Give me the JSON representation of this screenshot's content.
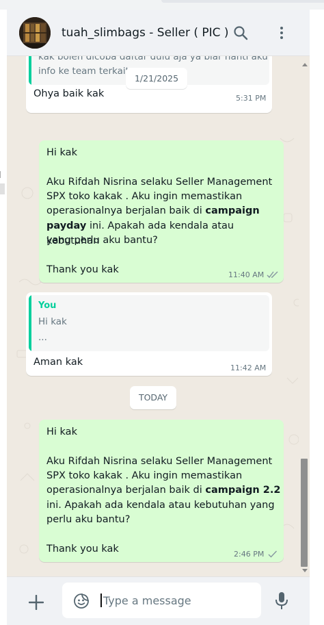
{
  "header": {
    "title": "tuah_slimbags - Seller ( PIC )",
    "search_icon": "search-icon",
    "menu_icon": "kebab-menu-icon"
  },
  "chat": {
    "partial_quote_line1": "kak boleh dicoba daftar dulu aja ya biar nanti aku",
    "partial_quote_line2": "info ke team terkait",
    "date_1": "1/21/2025",
    "msg1_text": "Ohya baik kak",
    "msg1_time": "5:31 PM",
    "msg2_greeting": "Hi kak",
    "msg2_line1": "Aku Rifdah Nisrina selaku Seller Management",
    "msg2_line2": "SPX toko kakak . Aku ingin memastikan",
    "msg2_line3a": "operasionalnya berjalan baik di ",
    "msg2_line3b": "campaign",
    "msg2_line4a": "payday",
    "msg2_line4b": " ini. Apakah ada kendala atau kebutuhan",
    "msg2_line5": "yang perlu aku bantu?",
    "msg2_closing": "Thank you kak",
    "msg2_time": "11:40 AM",
    "msg3_quote_author": "You",
    "msg3_quote_line1": "Hi kak",
    "msg3_quote_line2": "...",
    "msg3_text": "Aman kak",
    "msg3_time": "11:42 AM",
    "date_2": "TODAY",
    "msg4_greeting": "Hi kak",
    "msg4_line1": "Aku Rifdah Nisrina selaku Seller Management",
    "msg4_line2": "SPX toko kakak . Aku ingin memastikan",
    "msg4_line3a": "operasionalnya berjalan baik di ",
    "msg4_line3b": "campaign 2.2",
    "msg4_line4": "ini. Apakah ada kendala atau kebutuhan yang",
    "msg4_line5": "perlu aku bantu?",
    "msg4_closing": "Thank you kak",
    "msg4_time": "2:46 PM"
  },
  "footer": {
    "placeholder": "Type a message"
  },
  "colors": {
    "incoming": "#ffffff",
    "outgoing": "#d9fdd3",
    "accent": "#06cf9c",
    "tick_read": "#53bdeb"
  }
}
